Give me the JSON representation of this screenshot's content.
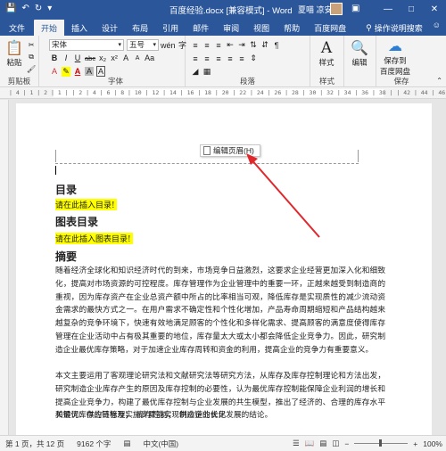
{
  "window": {
    "title": "百度经验.docx [兼容模式] - Word",
    "user": "夏喵 凉安",
    "save_icon": "save-icon",
    "undo_icon": "undo-icon",
    "redo_icon": "redo-icon"
  },
  "tabs": [
    "文件",
    "开始",
    "插入",
    "设计",
    "布局",
    "引用",
    "邮件",
    "审阅",
    "视图",
    "帮助",
    "百度网盘"
  ],
  "tell_me": "操作说明搜索",
  "ribbon": {
    "clipboard": {
      "paste": "粘贴",
      "label": "剪贴板"
    },
    "font": {
      "name": "宋体",
      "size": "五号",
      "label": "字体",
      "wen": "wén",
      "bold": "B",
      "italic": "I",
      "underline": "U",
      "strike": "abc",
      "sub": "x₂",
      "sup": "x²",
      "grow": "A",
      "shrink": "A",
      "aa": "Aa",
      "clear": "A",
      "font_color": "A",
      "char_border": "A",
      "char_shade": "A",
      "enclose": "字"
    },
    "paragraph": {
      "label": "段落"
    },
    "styles": {
      "button": "样式",
      "label": "样式",
      "style_icon": "A"
    },
    "editing": {
      "button": "编辑",
      "search_icon": "search-icon"
    },
    "save": {
      "button1": "保存到",
      "button2": "百度网盘",
      "label": "保存"
    }
  },
  "ruler_text": "| 4 | 1 | 2 | 1 |   | 2 | 4 | 6 | 8 | 10 | 12 | 14 | 16 | 18 | 20 | 22 | 24 | 26 | 28 | 30 | 32 | 34 | 36 | 38 |   | 42 | 44 | 46 | 48 |",
  "document": {
    "edit_header_tooltip": "编辑页眉(H)",
    "toc_heading": "目录",
    "toc_placeholder": "请在此插入目录!",
    "figures_heading": "图表目录",
    "figures_placeholder": "请在此插入图表目录!",
    "abstract_heading": "摘要",
    "abstract_para1": "随着经济全球化和知识经济时代的到来，市场竞争日益激烈，这要求企业经营更加深入化和细致化，提高对市场资源的可控程度。库存管理作为企业管理中的重要一环，正越来越受到制造商的重视，因为库存资产在企业总资产额中所占的比率相当可观，降低库存是实现质性的减少流动资金需求的最快方式之一。在用户需求不确定性和个性化增加，产品寿命周期缩短和产品结构越来越复杂的竞争环境下，快速有效地满足顾客的个性化和多样化需求、提高顾客的满意度使得库存管理在企业活动中占有极其重要的地位，库存量太大或太小都会降低企业竞争力。因此，研究制造企业最优库存策略，对于加速企业库存周转和资金的利用，提高企业的竞争力有重要意义。",
    "abstract_para2": "本文主要运用了客观理论研究法和文献研究法等研究方法，从库存及库存控制理论和方法出发，研究制造企业库存产生的原因及库存控制的必要性，认为最优库存控制能保障企业利润的增长和提高企业竞争力，构建了最优库存控制与企业发展的共生模型，推出了经济的、合理的库存水平和最优库存的目标及实施步骤能实现制造企业长足发展的结论。",
    "keywords": "关键词：供应链管理；　库存控制；　供应链的优化"
  },
  "status": {
    "page": "第 1 页，共 12 页",
    "words": "9162 个字",
    "lang": "中文(中国)",
    "zoom_level": "100%",
    "zoom_minus": "−",
    "zoom_plus": "+"
  },
  "colors": {
    "brand": "#2b579a",
    "highlight": "#ffff00",
    "arrow": "#e0282c"
  }
}
